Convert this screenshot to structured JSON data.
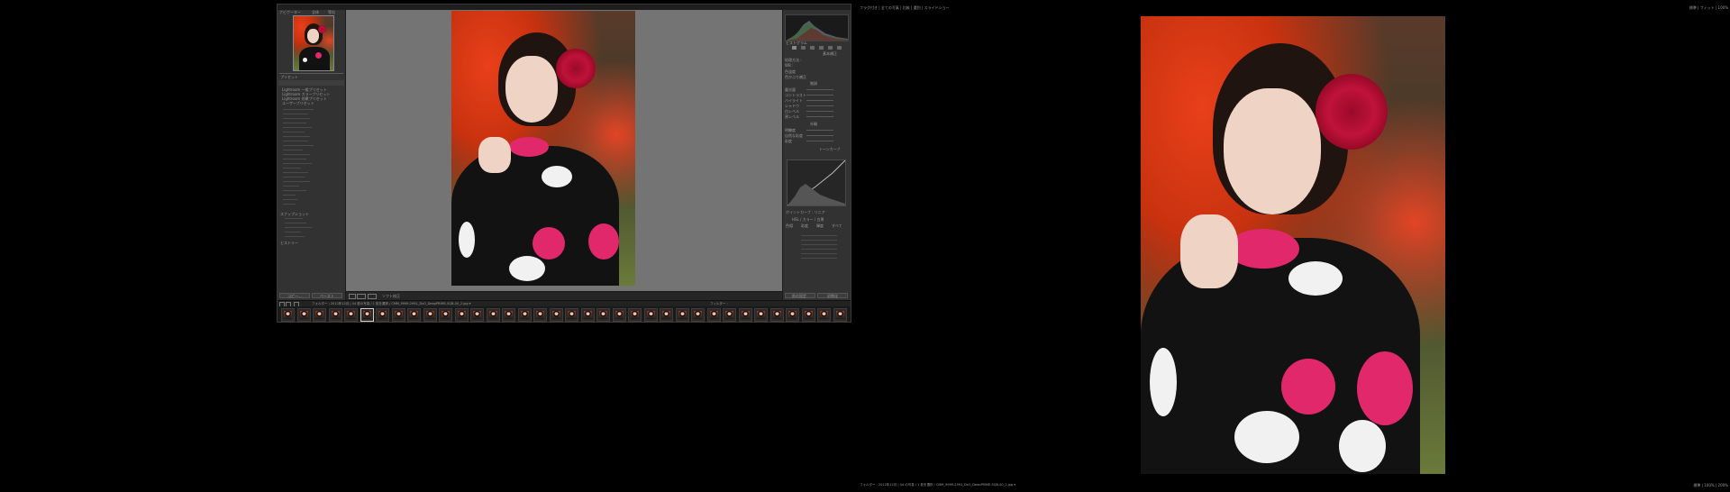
{
  "left_window": {
    "top_tabs": [
      "ナビゲーター",
      "全体",
      "等倍"
    ],
    "panel_left": {
      "presets_header": "プリセット",
      "preset_items": [
        "Lightroom 一般プリセット",
        "Lightroom カラープリセット",
        "Lightroom 効果プリセット",
        "ユーザープリセット"
      ],
      "snapshots_header": "スナップショット",
      "history_header": "ヒストリー",
      "buttons": [
        "コピー...",
        "ペースト"
      ]
    },
    "panel_right": {
      "hist_label": "ヒストグラム",
      "basic_header": "基本補正",
      "labels": [
        "処理方法 :",
        "WB :",
        "色温度",
        "色かぶり補正",
        "階調",
        "露光量",
        "コントラスト",
        "ハイライト",
        "シャドウ",
        "白レベル",
        "黒レベル",
        "外観",
        "明瞭度",
        "自然な彩度",
        "彩度"
      ],
      "tone_curve_header": "トーンカーブ",
      "curve_label": "ポイントカーブ : リニア",
      "hsl_header": "HSL / カラー / 白黒",
      "hsl_tabs": [
        "色相",
        "彩度",
        "輝度",
        "すべて"
      ],
      "bottom_buttons": [
        "前の設定",
        "初期化"
      ]
    },
    "toolbar": {
      "label": "ソフト校正"
    },
    "filmstrip_bar": {
      "path": "フォルダー : 2012年12月 | 44 枚の写真 / 1 枚を選択 / CMM_9999-2991_DxO_DeepPRIME-SQB-00_2.jpg ▾",
      "filter": "フィルター :"
    }
  },
  "right_window": {
    "top_left": "フラグ付き | 全ての写真 | 比較 | 選別 | スライドショー",
    "top_right": "標準 | フィット | 100%",
    "bottom_left": "フォルダー : 2012年12月 | 44 の写真 / 1 枚を選択 / CMM_9999-2991_DxO_DeepPRIME-SQB-00_2.jpg ▾",
    "bottom_right": "標準 | 100% | 200%"
  },
  "colors": {
    "background": "#000000",
    "panel": "#323232",
    "center_gray": "#747474",
    "leaf_red": "#e0401a",
    "flower_red": "#b0102e",
    "kimono_pink": "#e0286a"
  }
}
